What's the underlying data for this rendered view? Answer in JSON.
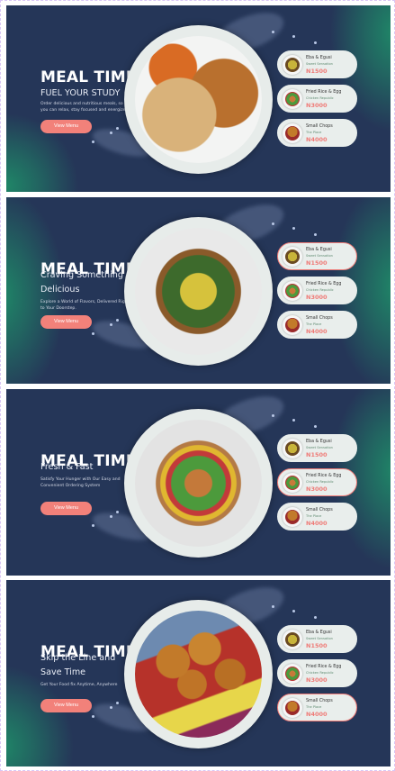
{
  "menu_items": [
    {
      "name": "Eba & Egusi",
      "vendor": "Sweet Sensation",
      "price": "N1500",
      "thumb": "egusi"
    },
    {
      "name": "Fried Rice & Egg",
      "vendor": "Chicken Republic",
      "price": "N3000",
      "thumb": "salad"
    },
    {
      "name": "Small Chops",
      "vendor": "The Place",
      "price": "N4000",
      "thumb": "chops"
    }
  ],
  "banners": [
    {
      "title": "MEAL TIME",
      "subtitle": "FUEL YOUR STUDY",
      "description": "Order delicious and nutritious meals, so you can relax, stay focused and energized.",
      "button": "View Menu",
      "food": "rice-chicken",
      "active_card": -1
    },
    {
      "title": "MEAL TIME",
      "subtitle": "Craving Something Delicious",
      "description": "Explore a World of Flavors, Delivered Right to Your Doorstep.",
      "button": "View Menu",
      "food": "egusi-bowl",
      "active_card": 0
    },
    {
      "title": "MEAL TIME",
      "subtitle": "Fresh & Fast",
      "description": "Satisfy Your Hunger with Our Easy and Convenient Ordering System",
      "button": "View Menu",
      "food": "salad-bowl",
      "active_card": 1
    },
    {
      "title": "MEAL TIME",
      "subtitle": "Skip the Line and Save Time",
      "description": "Get Your Food fix Anytime, Anywhere",
      "button": "View Menu",
      "food": "puff-puff",
      "active_card": 2
    }
  ],
  "colors": {
    "background": "#253658",
    "accent": "#f2817a",
    "glow": "#1f8a68"
  }
}
